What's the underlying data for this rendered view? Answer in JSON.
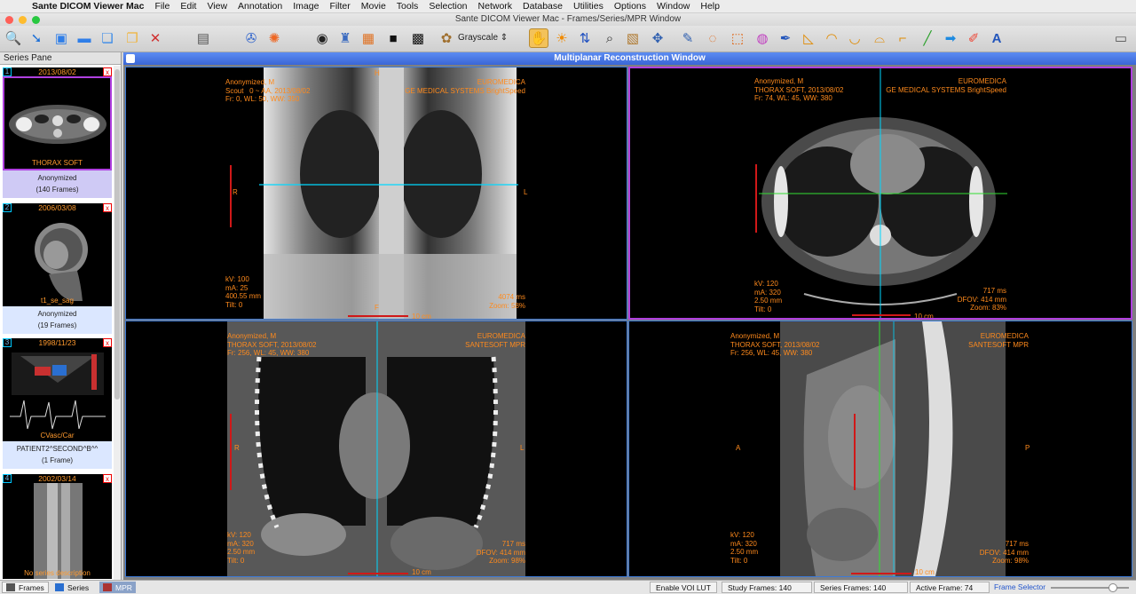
{
  "menubar": {
    "app": "Sante DICOM Viewer Mac",
    "items": [
      "File",
      "Edit",
      "View",
      "Annotation",
      "Image",
      "Filter",
      "Movie",
      "Tools",
      "Selection",
      "Network",
      "Database",
      "Utilities",
      "Options",
      "Window",
      "Help"
    ]
  },
  "window": {
    "title": "Sante DICOM Viewer Mac - Frames/Series/MPR Window"
  },
  "toolbar": {
    "lut_label": "Grayscale"
  },
  "series_pane": {
    "title": "Series Pane",
    "cards": [
      {
        "num": "1",
        "date": "2013/08/02",
        "name": "THORAX SOFT",
        "patient": "Anonymized",
        "frames": "(140 Frames)",
        "selected": true
      },
      {
        "num": "2",
        "date": "2006/03/08",
        "name": "t1_se_sag",
        "patient": "Anonymized",
        "frames": "(19 Frames)",
        "selected": false
      },
      {
        "num": "3",
        "date": "1998/11/23",
        "name": "CVasc/Car",
        "patient": "PATIENT2^SECOND^B^^",
        "frames": "(1 Frame)",
        "selected": false
      },
      {
        "num": "4",
        "date": "2002/03/14",
        "name": "No series description",
        "patient": "",
        "frames": "",
        "selected": false
      }
    ]
  },
  "mpr": {
    "title": "Multiplanar Reconstruction Window",
    "scale_label": "10 cm",
    "viewports": [
      {
        "tl": "Anonymized, M\nScout   0 ~ AA, 2013/08/02\nFr: 0, WL: 50, WW: 350",
        "tr": "EUROMEDICA\nGE MEDICAL SYSTEMS BrightSpeed",
        "bl": "kV: 100\nmA: 25\n400.55 mm\nTilt: 0",
        "br": "4074 ms\nZoom: 58%",
        "left": "R",
        "right": "L",
        "top": "H",
        "bottom": "F"
      },
      {
        "tl": "Anonymized, M\nTHORAX SOFT, 2013/08/02\nFr: 74, WL: 45, WW: 380",
        "tr": "EUROMEDICA\nGE MEDICAL SYSTEMS BrightSpeed",
        "bl": "kV: 120\nmA: 320\n2.50 mm\nTilt: 0",
        "br": "717 ms\nDFOV: 414 mm\nZoom: 83%",
        "left": "",
        "right": "",
        "top": "",
        "bottom": ""
      },
      {
        "tl": "Anonymized, M\nTHORAX SOFT, 2013/08/02\nFr: 256, WL: 45, WW: 380",
        "tr": "EUROMEDICA\nSANTESOFT MPR",
        "bl": "kV: 120\nmA: 320\n2.50 mm\nTilt: 0",
        "br": "717 ms\nDFOV: 414 mm\nZoom: 98%",
        "left": "R",
        "right": "L",
        "top": "",
        "bottom": ""
      },
      {
        "tl": "Anonymized, M\nTHORAX SOFT, 2013/08/02\nFr: 256, WL: 45, WW: 380",
        "tr": "EUROMEDICA\nSANTESOFT MPR",
        "bl": "kV: 120\nmA: 320\n2.50 mm\nTilt: 0",
        "br": "717 ms\nDFOV: 414 mm\nZoom: 98%",
        "left": "A",
        "right": "P",
        "top": "",
        "bottom": ""
      }
    ]
  },
  "statusbar": {
    "tabs": [
      "Frames",
      "Series",
      "MPR"
    ],
    "voi": "Enable VOI LUT",
    "study_frames": "Study Frames: 140",
    "series_frames": "Series Frames: 140",
    "active_frame": "Active Frame: 74",
    "frame_selector": "Frame Selector",
    "frame_selector_position": 0.83
  },
  "colors": {
    "overlay": "#ff8a1c",
    "title_bar": "#3a66d6",
    "crosshair_cyan": "#00d8ff",
    "crosshair_green": "#33dd33",
    "selected_border": "#b040e0",
    "active_border": "#3c7ad8"
  }
}
